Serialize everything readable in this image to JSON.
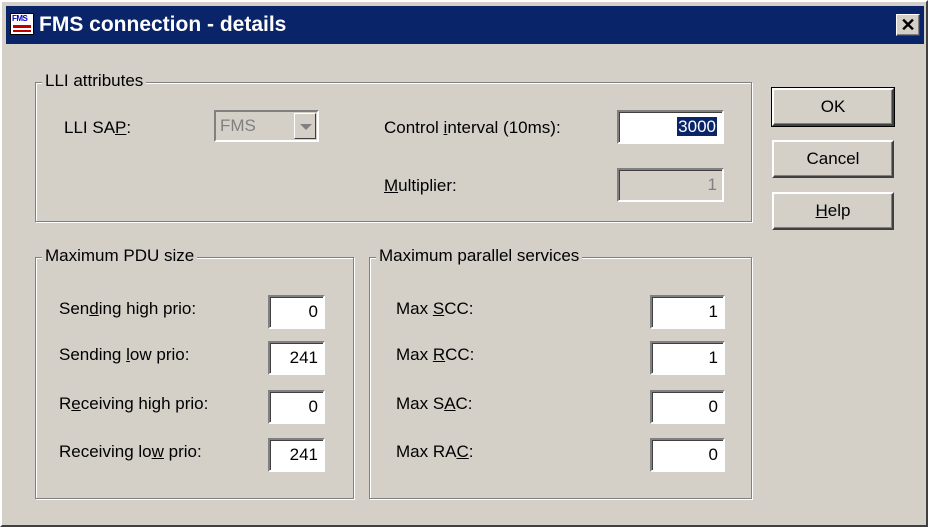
{
  "window": {
    "title": "FMS connection - details",
    "icon": "fms-app-icon",
    "close_label": "✕"
  },
  "lli": {
    "group_label": "LLI attributes",
    "sap_label_pre": "LLI SA",
    "sap_label_ul": "P",
    "sap_label_post": ":",
    "sap_value": "FMS",
    "control_label_pre": "Control ",
    "control_label_ul": "i",
    "control_label_post": "nterval (10ms):",
    "control_value": "3000",
    "multiplier_label_ul": "M",
    "multiplier_label_post": "ultiplier:",
    "multiplier_value": "1"
  },
  "pdu": {
    "group_label": "Maximum PDU size",
    "rows": [
      {
        "pre": "Sen",
        "ul": "d",
        "post": "ing high prio:",
        "value": "0"
      },
      {
        "pre": "Sending ",
        "ul": "l",
        "post": "ow prio:",
        "value": "241"
      },
      {
        "pre": "R",
        "ul": "e",
        "post": "ceiving high prio:",
        "value": "0"
      },
      {
        "pre": "Receiving lo",
        "ul": "w",
        "post": " prio:",
        "value": "241"
      }
    ]
  },
  "parallel": {
    "group_label": "Maximum parallel services",
    "rows": [
      {
        "pre": "Max ",
        "ul": "S",
        "post": "CC:",
        "value": "1"
      },
      {
        "pre": "Max ",
        "ul": "R",
        "post": "CC:",
        "value": "1"
      },
      {
        "pre": "Max S",
        "ul": "A",
        "post": "C:",
        "value": "0"
      },
      {
        "pre": "Max RA",
        "ul": "C",
        "post": ":",
        "value": "0"
      }
    ]
  },
  "buttons": {
    "ok": "OK",
    "cancel": "Cancel",
    "help_ul": "H",
    "help_post": "elp"
  }
}
